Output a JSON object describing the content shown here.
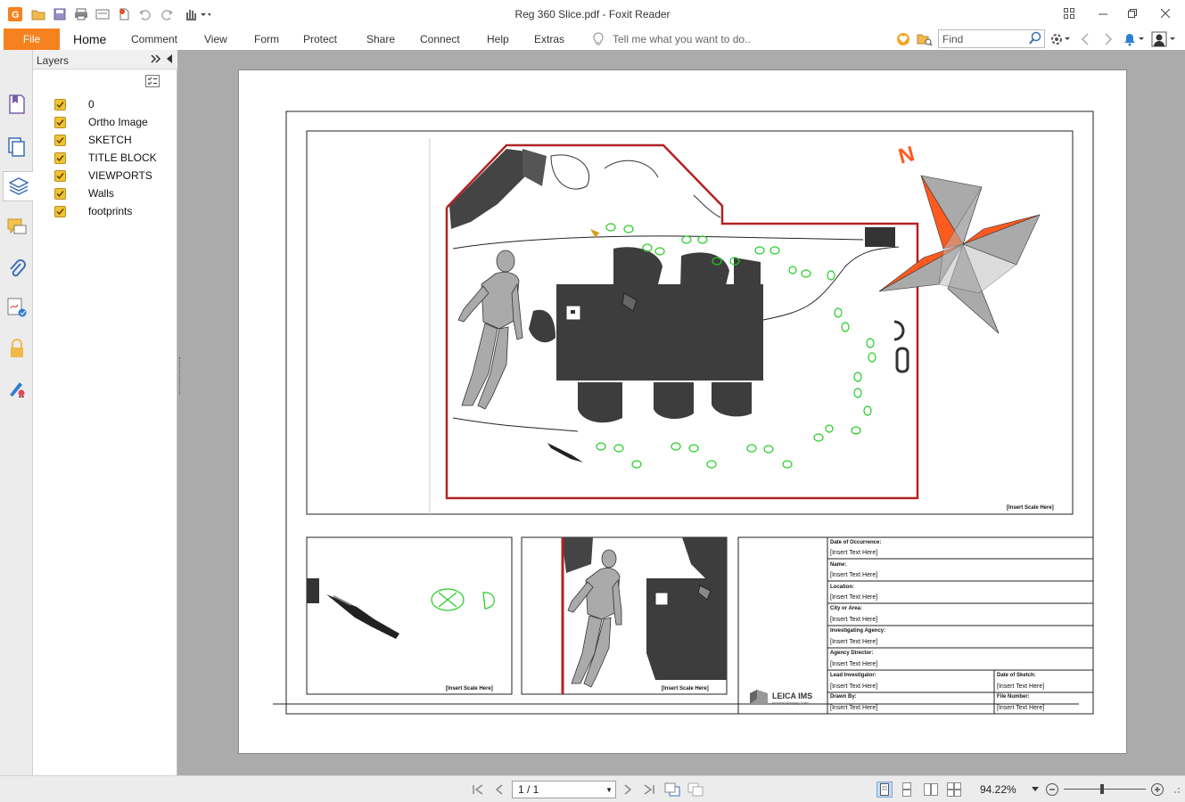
{
  "window": {
    "title": "Reg 360 Slice.pdf - Foxit Reader"
  },
  "menu": {
    "file": "File",
    "items": [
      "Home",
      "Comment",
      "View",
      "Form",
      "Protect",
      "Share",
      "Connect",
      "Help",
      "Extras"
    ],
    "tell_me": "Tell me what you want to do..",
    "find_placeholder": "Find"
  },
  "layers_panel": {
    "title": "Layers",
    "layers": [
      {
        "name": "0",
        "checked": true
      },
      {
        "name": "Ortho Image",
        "checked": true
      },
      {
        "name": "SKETCH",
        "checked": true
      },
      {
        "name": "TITLE BLOCK",
        "checked": true
      },
      {
        "name": "VIEWPORTS",
        "checked": true
      },
      {
        "name": "Walls",
        "checked": true
      },
      {
        "name": "footprints",
        "checked": true
      }
    ]
  },
  "drawing": {
    "north_label": "N",
    "scale_main": "[Insert Scale Here]",
    "scale_small_1": "[Insert Scale Here]",
    "scale_small_2": "[Insert Scale Here]",
    "logo_name": "LEICA IMS",
    "logo_sub": "Incident Mapping Suite",
    "title_block": [
      {
        "label": "Date of Occurrence:",
        "value": "[Insert Text Here]"
      },
      {
        "label": "Name:",
        "value": "[Insert Text Here]"
      },
      {
        "label": "Location:",
        "value": "[Insert Text Here]"
      },
      {
        "label": "City or Area:",
        "value": "[Insert Text Here]"
      },
      {
        "label": "Investigating Agency:",
        "value": "[Insert Text Here]"
      },
      {
        "label": "Agency Director:",
        "value": "[Insert Text Here]"
      }
    ],
    "title_block_split": [
      {
        "left_label": "Lead Investigator:",
        "left_value": "[Insert Text Here]",
        "right_label": "Date of Sketch:",
        "right_value": "[Insert Text Here]"
      },
      {
        "left_label": "Drawn By:",
        "left_value": "[Insert Text Here]",
        "right_label": "File Number:",
        "right_value": "[Insert Text Here]"
      }
    ]
  },
  "status": {
    "page_indicator": "1 / 1",
    "zoom": "94.22%",
    "zoom_level": 0.47
  },
  "colors": {
    "accent": "#f5821f",
    "walls": "#b22222",
    "footprints": "#22cc22",
    "compass": "#ff5a1f"
  }
}
